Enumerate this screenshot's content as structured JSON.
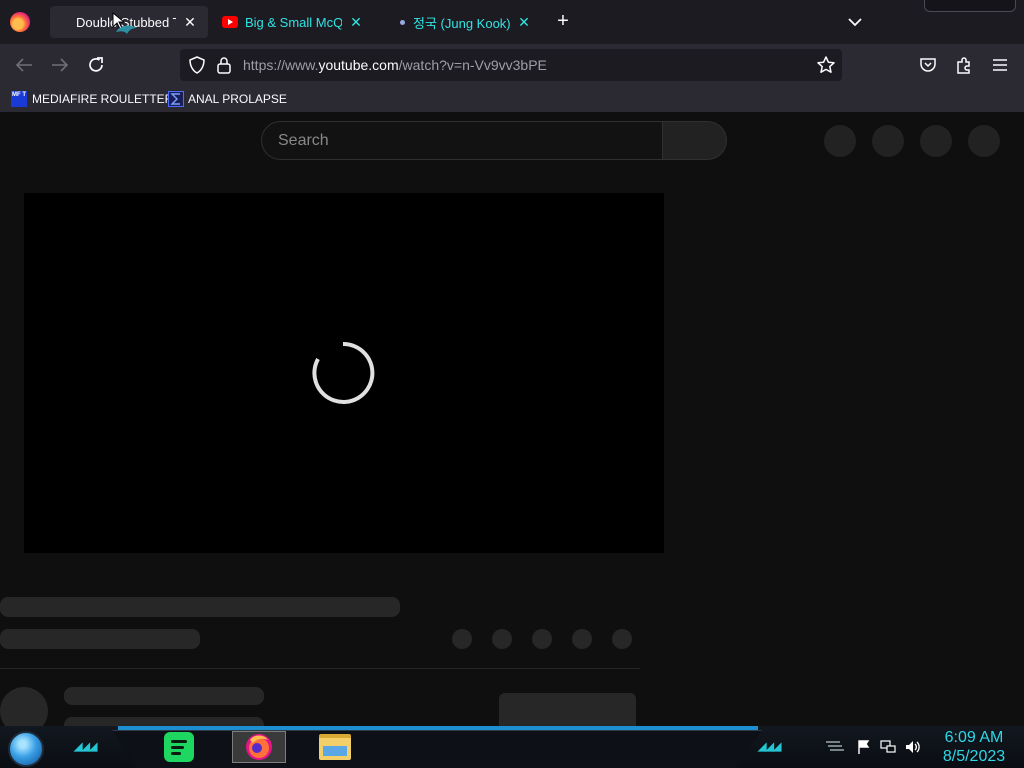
{
  "browser": {
    "tabs": [
      {
        "title": "Double Stubbed Trap",
        "close": "✕"
      },
      {
        "title": "Big & Small McQueen",
        "close": "✕"
      },
      {
        "title": "정국 (Jung Kook) 'Se",
        "close": "✕"
      }
    ],
    "new_tab": "+",
    "tab_list": "⌄"
  },
  "navbar": {
    "url_prefix": "https://www.",
    "url_host": "youtube.com",
    "url_path": "/watch?v=n-Vv9vv3bPE"
  },
  "bookmarks": [
    {
      "label": "MEDIAFIRE ROULETTER",
      "icon_text": "MF T"
    },
    {
      "label": "ANAL PROLAPSE"
    }
  ],
  "youtube": {
    "search_placeholder": "Search",
    "loading": true
  },
  "taskbar": {
    "time": "6:09 AM",
    "date": "8/5/2023",
    "apps": [
      "spotify-icon",
      "firefox-icon",
      "file-explorer-icon"
    ]
  },
  "colors": {
    "accent": "#31e3e3",
    "youtube_red": "#ff0000",
    "clock": "#2fd6e6"
  }
}
